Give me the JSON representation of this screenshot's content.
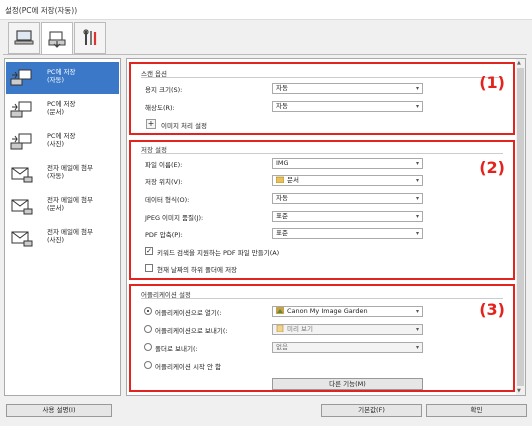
{
  "window": {
    "title": "설정(PC에 저장(자동))"
  },
  "tabs": [
    {
      "icon": "computer-scan-icon"
    },
    {
      "icon": "scanner-icon"
    },
    {
      "icon": "tools-icon"
    }
  ],
  "sidebar": {
    "items": [
      {
        "label": "PC에 저장\n(자동)",
        "icon": "save-auto-icon",
        "selected": true
      },
      {
        "label": "PC에 저장\n(문서)",
        "icon": "save-document-icon"
      },
      {
        "label": "PC에 저장\n(사진)",
        "icon": "save-photo-icon"
      },
      {
        "label": "전자 메일에 첨부\n(자동)",
        "icon": "email-auto-icon"
      },
      {
        "label": "전자 메일에 첨부\n(문서)",
        "icon": "email-document-icon"
      },
      {
        "label": "전자 메일에 첨부\n(사진)",
        "icon": "email-photo-icon"
      }
    ]
  },
  "scan_options": {
    "title": "스캔 옵션",
    "number": "(1)",
    "paper_size_label": "용지 크기(S):",
    "paper_size_value": "자동",
    "resolution_label": "해상도(R):",
    "resolution_value": "자동",
    "image_processing_label": "이미지 처리 설정"
  },
  "save_settings": {
    "title": "저장 설정",
    "number": "(2)",
    "file_name_label": "파일 이름(E):",
    "file_name_value": "IMG",
    "save_in_label": "저장 위치(V):",
    "save_in_value": "문서",
    "data_format_label": "데이터 형식(O):",
    "data_format_value": "자동",
    "jpeg_quality_label": "JPEG 이미지 품질(J):",
    "jpeg_quality_value": "표준",
    "pdf_compression_label": "PDF 압축(P):",
    "pdf_compression_value": "표준",
    "keyword_pdf_label": "키워드 검색을 지원하는 PDF 파일 만들기(A)",
    "keyword_pdf_checked": true,
    "subfolder_label": "현재 날짜의 하위 폴더에 저장",
    "subfolder_checked": false
  },
  "app_settings": {
    "title": "어플리케이션 설정",
    "number": "(3)",
    "open_with_label": "어플리케이션으로 열기(:",
    "open_with_value": "Canon My Image Garden",
    "send_to_app_label": "어플리케이션으로 보내기(:",
    "send_to_app_value": "미리 보기",
    "send_to_folder_label": "폴더로 보내기(:",
    "send_to_folder_value": "없음",
    "no_app_label": "어플리케이션 시작 안 함",
    "more_functions_label": "다른 기능(M)",
    "selected_option": "open_with"
  },
  "footer": {
    "instructions_label": "사용 설명(I)",
    "defaults_label": "기본값(F)",
    "ok_label": "확인"
  }
}
